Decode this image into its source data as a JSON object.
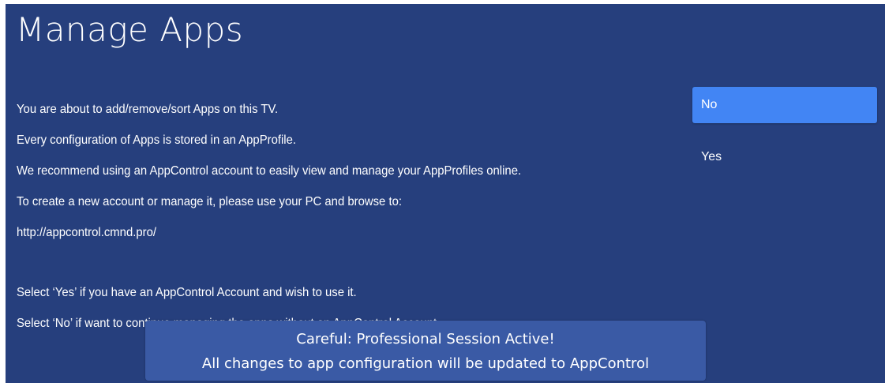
{
  "header": {
    "title": "Manage Apps"
  },
  "message": {
    "lines": [
      "You are about to add/remove/sort Apps on this TV.",
      "Every configuration of Apps is stored in an AppProfile.",
      "We recommend using an AppControl account to easily view and manage your AppProfiles online.",
      "To create a new account or manage it, please use your PC and browse to:",
      "http://appcontrol.cmnd.pro/",
      "Select ‘Yes’ if you have an AppControl Account and wish to use it.",
      "Select ‘No’ if want to continue managing the apps without an AppControl Account."
    ]
  },
  "options": {
    "no_label": "No",
    "yes_label": "Yes",
    "selected": "No"
  },
  "toast": {
    "line1": "Careful: Professional Session Active!",
    "line2": "All changes to app configuration will be updated to AppControl"
  },
  "colors": {
    "background": "#263f7d",
    "selected_option": "#4285f4",
    "toast_background": "#3a5aa5",
    "text": "#ffffff"
  }
}
